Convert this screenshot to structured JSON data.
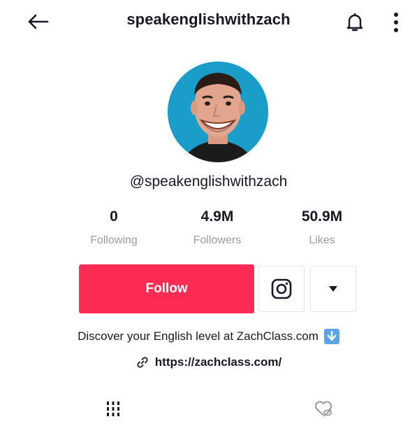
{
  "header": {
    "title": "speakenglishwithzach",
    "back_icon": "arrow-left-icon",
    "bell_icon": "bell-icon",
    "more_icon": "more-vertical-icon"
  },
  "profile": {
    "username": "@speakenglishwithzach",
    "avatar_bg": "#1a9dc9"
  },
  "stats": [
    {
      "value": "0",
      "label": "Following"
    },
    {
      "value": "4.9M",
      "label": "Followers"
    },
    {
      "value": "50.9M",
      "label": "Likes"
    }
  ],
  "actions": {
    "follow_label": "Follow",
    "follow_color": "#fe2c55",
    "instagram_icon": "instagram-icon",
    "dropdown_icon": "caret-down-icon"
  },
  "bio": {
    "text": "Discover your English level at ZachClass.com",
    "emoji_icon": "down-arrow-emoji-icon",
    "link": "https://zachclass.com/",
    "link_icon": "link-icon"
  },
  "tabs": [
    {
      "icon": "grid-icon"
    },
    {
      "icon": "liked-hidden-icon"
    }
  ]
}
